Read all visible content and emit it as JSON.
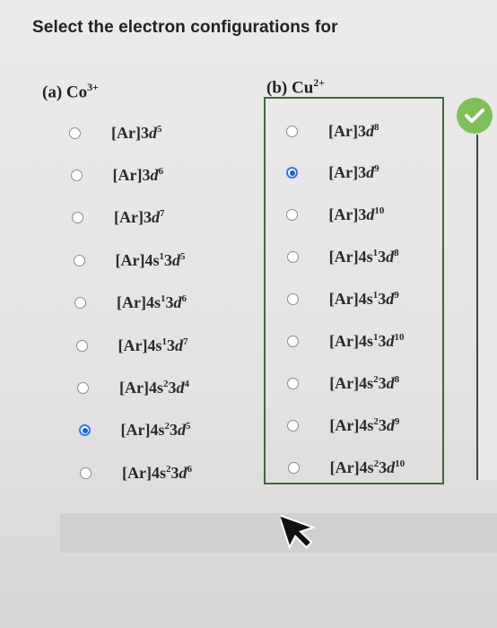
{
  "question": "Select the electron configurations for",
  "part_a": {
    "label": "(a) Co",
    "charge": "3+",
    "options": [
      {
        "base": "[Ar]3",
        "d": "d",
        "exp": "5",
        "selected": false
      },
      {
        "base": "[Ar]3",
        "d": "d",
        "exp": "6",
        "selected": false
      },
      {
        "base": "[Ar]3",
        "d": "d",
        "exp": "7",
        "selected": false
      },
      {
        "base": "[Ar]4s",
        "s_exp": "1",
        "mid": "3",
        "d": "d",
        "exp": "5",
        "selected": false
      },
      {
        "base": "[Ar]4s",
        "s_exp": "1",
        "mid": "3",
        "d": "d",
        "exp": "6",
        "selected": false
      },
      {
        "base": "[Ar]4s",
        "s_exp": "1",
        "mid": "3",
        "d": "d",
        "exp": "7",
        "selected": false
      },
      {
        "base": "[Ar]4s",
        "s_exp": "2",
        "mid": "3",
        "d": "d",
        "exp": "4",
        "selected": false
      },
      {
        "base": "[Ar]4s",
        "s_exp": "2",
        "mid": "3",
        "d": "d",
        "exp": "5",
        "selected": true
      },
      {
        "base": "[Ar]4s",
        "s_exp": "2",
        "mid": "3",
        "d": "d",
        "exp": "6",
        "selected": false
      }
    ]
  },
  "part_b": {
    "label": "(b) Cu",
    "charge": "2+",
    "options": [
      {
        "base": "[Ar]3",
        "d": "d",
        "exp": "8",
        "selected": false
      },
      {
        "base": "[Ar]3",
        "d": "d",
        "exp": "9",
        "selected": true
      },
      {
        "base": "[Ar]3",
        "d": "d",
        "exp": "10",
        "selected": false
      },
      {
        "base": "[Ar]4s",
        "s_exp": "1",
        "mid": "3",
        "d": "d",
        "exp": "8",
        "selected": false
      },
      {
        "base": "[Ar]4s",
        "s_exp": "1",
        "mid": "3",
        "d": "d",
        "exp": "9",
        "selected": false
      },
      {
        "base": "[Ar]4s",
        "s_exp": "1",
        "mid": "3",
        "d": "d",
        "exp": "10",
        "selected": false
      },
      {
        "base": "[Ar]4s",
        "s_exp": "2",
        "mid": "3",
        "d": "d",
        "exp": "8",
        "selected": false
      },
      {
        "base": "[Ar]4s",
        "s_exp": "2",
        "mid": "3",
        "d": "d",
        "exp": "9",
        "selected": false
      },
      {
        "base": "[Ar]4s",
        "s_exp": "2",
        "mid": "3",
        "d": "d",
        "exp": "10",
        "selected": false
      }
    ]
  },
  "colors": {
    "check_green": "#7fbf5a",
    "box_border": "#3d6b3a",
    "radio_selected": "#1a5ec6"
  },
  "icons": {
    "correct": "check-circle-icon",
    "cursor": "mouse-pointer-icon"
  }
}
